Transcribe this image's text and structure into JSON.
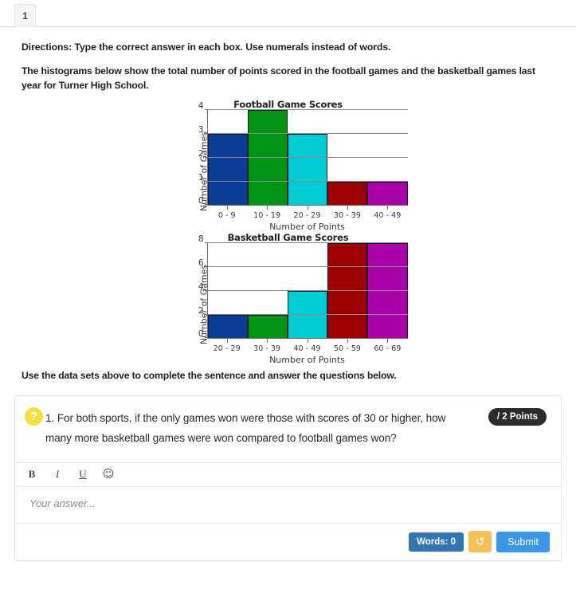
{
  "tab": {
    "label": "1"
  },
  "instructions": {
    "directions": "Directions: Type the correct answer in each box. Use numerals instead of words.",
    "intro": "The histograms below show the total number of points scored in the football games and the basketball games last year for Turner High School.",
    "closing": "Use the data sets above to complete the sentence and answer the questions below."
  },
  "chart_data": [
    {
      "type": "bar",
      "title": "Football Game Scores",
      "xlabel": "Number of Points",
      "ylabel": "Number of Games",
      "categories": [
        "0 - 9",
        "10 - 19",
        "20 - 29",
        "30 - 39",
        "40 - 49"
      ],
      "values": [
        3,
        4,
        3,
        1,
        1
      ],
      "colors": [
        "#0b3c96",
        "#009414",
        "#00ccd6",
        "#9c0000",
        "#a900a9"
      ],
      "yticks": [
        0,
        1,
        2,
        3,
        4
      ],
      "ylim": [
        0,
        4
      ],
      "grid": true,
      "legend": "none"
    },
    {
      "type": "bar",
      "title": "Basketball Game Scores",
      "xlabel": "Number of Points",
      "ylabel": "Number of Games",
      "categories": [
        "20 - 29",
        "30 - 39",
        "40 - 49",
        "50 - 59",
        "60 - 69"
      ],
      "values": [
        2,
        2,
        4,
        8,
        8
      ],
      "colors": [
        "#0b3c96",
        "#009414",
        "#00ccd6",
        "#9c0000",
        "#a900a9"
      ],
      "yticks": [
        0,
        2,
        4,
        6,
        8
      ],
      "ylim": [
        0,
        8
      ],
      "grid": true,
      "legend": "none"
    }
  ],
  "question": {
    "help_icon": "question-mark",
    "number": "1.",
    "text": "1. For both sports, if the only games won were those with scores of 30 or higher, how many more basketball games were won compared to football games won?",
    "points_badge": "/ 2 Points",
    "toolbar": {
      "bold": "B",
      "italic": "I",
      "underline": "U",
      "emoji": "☺"
    },
    "answer_placeholder": "Your answer...",
    "words_badge": "Words: 0",
    "reset_icon": "↺",
    "submit_label": "Submit"
  },
  "colors": {
    "accent_blue": "#3b97e3",
    "badge_blue": "#3276b1",
    "reset_orange": "#f5bf5c",
    "help_yellow": "#f5e13c",
    "badge_dark": "#2c2c2c"
  }
}
